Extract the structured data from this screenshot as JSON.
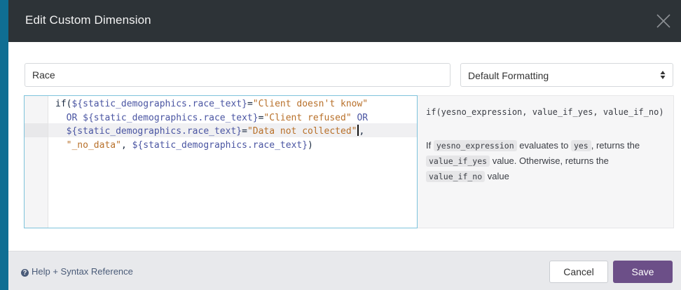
{
  "dialog": {
    "title": "Edit Custom Dimension"
  },
  "name_field": {
    "value": "Race",
    "placeholder": ""
  },
  "formatting_select": {
    "selected": "Default Formatting"
  },
  "code_lines": [
    [
      {
        "t": "kw",
        "v": "if("
      },
      {
        "t": "var",
        "v": "${static_demographics.race_text}"
      },
      {
        "t": "op",
        "v": "="
      },
      {
        "t": "str",
        "v": "\"Client doesn't know\""
      }
    ],
    [
      {
        "t": "op",
        "v": "  "
      },
      {
        "t": "var",
        "v": "OR ${static_demographics.race_text}"
      },
      {
        "t": "op",
        "v": "="
      },
      {
        "t": "str",
        "v": "\"Client refused\""
      },
      {
        "t": "op",
        "v": " "
      },
      {
        "t": "var",
        "v": "OR"
      }
    ],
    [
      {
        "t": "op",
        "v": "  "
      },
      {
        "t": "var",
        "v": "${static_demographics.race_text}"
      },
      {
        "t": "op",
        "v": "="
      },
      {
        "t": "str",
        "v": "\"Data not collected\""
      },
      {
        "t": "cursor",
        "v": ""
      },
      {
        "t": "op",
        "v": ","
      }
    ],
    [
      {
        "t": "op",
        "v": "  "
      },
      {
        "t": "str",
        "v": "\"_no_data\""
      },
      {
        "t": "op",
        "v": ", "
      },
      {
        "t": "var",
        "v": "${static_demographics.race_text}"
      },
      {
        "t": "op",
        "v": ")"
      }
    ]
  ],
  "help": {
    "signature": "if(yesno_expression, value_if_yes, value_if_no)",
    "desc_1": "If ",
    "chip_1": "yesno_expression",
    "desc_2": " evaluates to ",
    "chip_2": "yes",
    "desc_3": ", returns the ",
    "chip_3": "value_if_yes",
    "desc_4": " value. Otherwise, returns the ",
    "chip_4": "value_if_no",
    "desc_5": " value"
  },
  "footer": {
    "help_link": "Help + Syntax Reference",
    "cancel_label": "Cancel",
    "save_label": "Save"
  },
  "colors": {
    "header_bg": "#2d3337",
    "save_button": "#6c4f88",
    "editor_border": "#7ec3dc",
    "string_token": "#b8702a",
    "variable_token": "#4a55a2"
  },
  "icons": {
    "close": "close-icon",
    "help": "question-circle-icon",
    "select_arrows": "sort-arrows-icon"
  }
}
